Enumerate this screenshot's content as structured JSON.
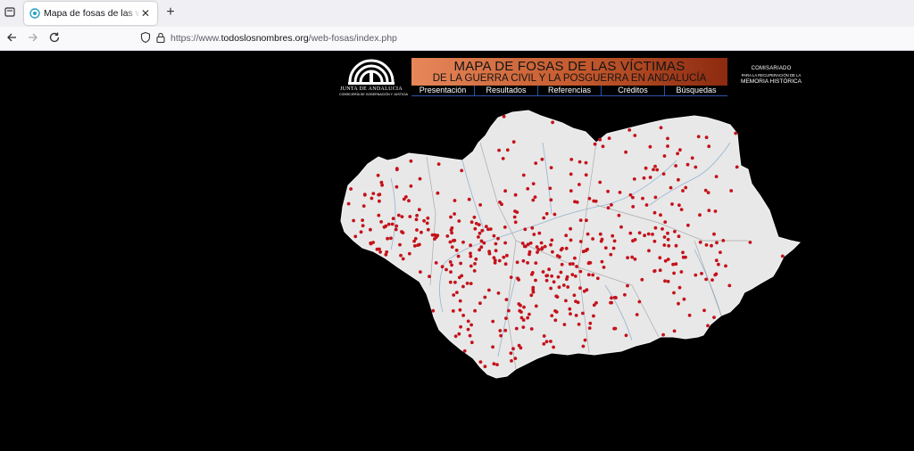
{
  "browser": {
    "tab": {
      "title": "Mapa de fosas de las víctimas de la Guerra Civil"
    },
    "url": {
      "prefix": "https://www.",
      "host": "todoslosnombres.org",
      "path": "/web-fosas/index.php"
    }
  },
  "header": {
    "junta_name": "JUNTA DE ANDALUCIA",
    "junta_subtitle": "CONSEJERÍA DE GOBERNACIÓN Y JUSTICIA",
    "title": "MAPA DE FOSAS DE LAS VÍCTIMAS",
    "subtitle": "DE LA GUERRA CIVIL Y LA POSGUERRA EN ANDALUCÍA",
    "menu": [
      "Presentación",
      "Resultados",
      "Referencias",
      "Créditos",
      "Búsquedas"
    ],
    "comisariado": {
      "line1": "COMISARIADO",
      "line2": "PARA LA RECUPERACIÓN DE LA",
      "line3": "MEMORIA HISTÓRICA"
    }
  },
  "map": {
    "land_color": "#e8e8e8",
    "marker_color": "#c4121a",
    "river_color": "#7fa6cc"
  }
}
